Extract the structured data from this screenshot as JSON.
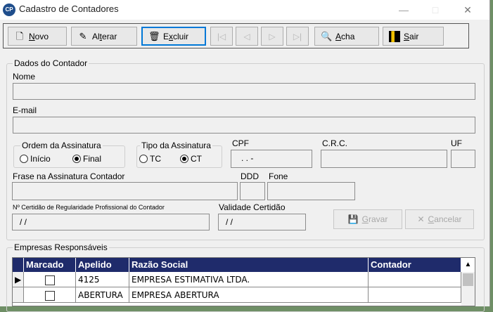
{
  "window": {
    "title": "Cadastro de Contadores",
    "minimize": "—",
    "maximize": "□",
    "close": "✕"
  },
  "toolbar": {
    "novo": {
      "pre": "",
      "u": "N",
      "post": "ovo"
    },
    "alterar": {
      "pre": "Al",
      "u": "t",
      "post": "erar"
    },
    "excluir": {
      "pre": "E",
      "u": "x",
      "post": "cluir"
    },
    "acha": {
      "pre": "",
      "u": "A",
      "post": "cha"
    },
    "sair": {
      "pre": "",
      "u": "S",
      "post": "air"
    }
  },
  "dados": {
    "group_label": "Dados do Contador",
    "nome_label": "Nome",
    "nome_value": "",
    "email_label": "E-mail",
    "email_value": "",
    "ordem_label": "Ordem da Assinatura",
    "ordem_inicio": "Início",
    "ordem_final": "Final",
    "tipo_label": "Tipo da Assinatura",
    "tipo_tc": "TC",
    "tipo_ct": "CT",
    "cpf_label": "CPF",
    "cpf_value": ". . -",
    "crc_label": "C.R.C.",
    "crc_value": "",
    "uf_label": "UF",
    "uf_value": "",
    "frase_label": "Frase na Assinatura Contador",
    "frase_value": "",
    "ddd_label": "DDD",
    "ddd_value": "",
    "fone_label": "Fone",
    "fone_value": "",
    "certidao_label": "Nº Certidão de Regularidade Profissional do Contador",
    "certidao_value": "/ /",
    "validade_label": "Validade Certidão",
    "validade_value": "/ /",
    "gravar": {
      "pre": "",
      "u": "G",
      "post": "ravar"
    },
    "cancelar": {
      "pre": "",
      "u": "C",
      "post": "ancelar"
    }
  },
  "empresas": {
    "group_label": "Empresas Responsáveis",
    "columns": [
      "Marcado",
      "Apelido",
      "Razão Social",
      "Contador"
    ],
    "rows": [
      {
        "apelido": "4125",
        "razao": "EMPRESA ESTIMATIVA LTDA.",
        "contador": ""
      },
      {
        "apelido": "ABERTURA",
        "razao": "EMPRESA ABERTURA",
        "contador": ""
      }
    ]
  },
  "colors": {
    "grid_header": "#1f2b6b",
    "focus": "#0078d7"
  }
}
